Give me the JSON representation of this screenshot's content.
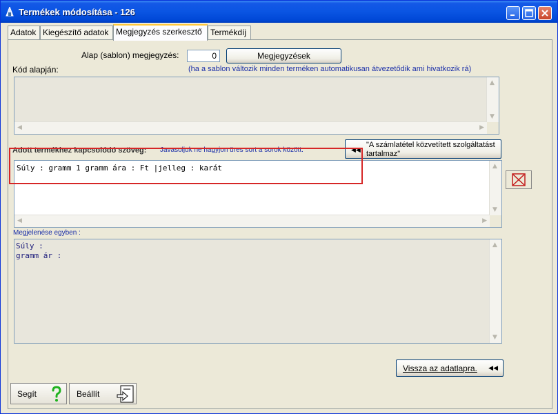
{
  "window": {
    "title": "Termékek módosítása - 126"
  },
  "tabs": [
    {
      "label": "Adatok"
    },
    {
      "label": "Kiegészítő adatok"
    },
    {
      "label": "Megjegyzés szerkesztő"
    },
    {
      "label": "Termékdíj"
    }
  ],
  "template": {
    "label": "Alap (sablon) megjegyzés:",
    "value": "0",
    "button_label": "Megjegyzések",
    "hint": "(ha a sablon változik minden terméken automatikusan átvezetődik ami hivatkozik rá)"
  },
  "code_section": {
    "label": "Kód alapján:"
  },
  "product_text": {
    "label": "Adott termékhez kapcsolódó szöveg:",
    "hint": "Javasoljuk ne hagyjon üres sort a sorok között.",
    "button_label": "\"A számlatétel közvetített szolgáltatást tartalmaz\"",
    "line": "Súly     :    gramm      1 gramm ára :     Ft     |jelleg :     karát"
  },
  "preview": {
    "label": "Megjelenése egyben :",
    "lines": [
      "Súly     :",
      "gramm ár :"
    ]
  },
  "back_button": {
    "label": "Vissza az adatlapra."
  },
  "help_button": {
    "label": "Segít"
  },
  "settings_button": {
    "label": "Beállít"
  },
  "colors": {
    "title_bar": "#0a55e3",
    "highlight": "#d62626",
    "hint": "#1a2ea8"
  }
}
